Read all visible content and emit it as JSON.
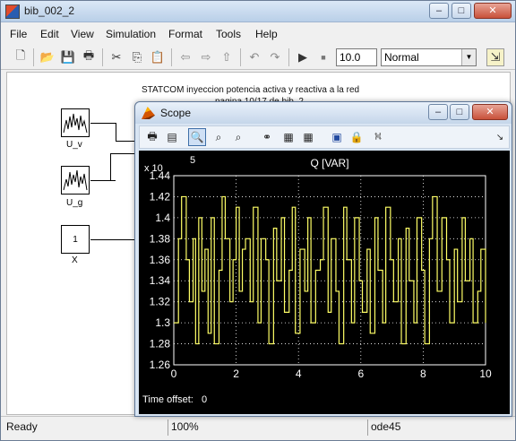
{
  "window": {
    "title": "bib_002_2",
    "controls": [
      "–",
      "□",
      "✕"
    ]
  },
  "menubar": [
    "File",
    "Edit",
    "View",
    "Simulation",
    "Format",
    "Tools",
    "Help"
  ],
  "toolbar": {
    "icons": [
      "new-icon",
      "open-icon",
      "save-icon",
      "print-icon",
      "cut-icon",
      "copy-icon",
      "paste-icon",
      "back-icon",
      "forward-icon",
      "up-icon",
      "undo-icon",
      "redo-icon",
      "play-icon",
      "stop-icon"
    ],
    "sim_time": "10.0",
    "sim_mode": "Normal"
  },
  "model": {
    "note_line1": "STATCOM inyeccion potencia activa y reactiva a la red",
    "note_line2": "pagina 10/17 de bib_2",
    "blocks": [
      {
        "label": "U_v",
        "content": ""
      },
      {
        "label": "U_g",
        "content": ""
      },
      {
        "label": "X",
        "content": "1"
      }
    ]
  },
  "scope": {
    "title": "Scope",
    "toolbar_icons": [
      "print-icon",
      "params-icon",
      "zoom-icon",
      "zoom-x-icon",
      "zoom-y-icon",
      "binoculars-icon",
      "save-axes-icon",
      "restore-axes-icon",
      "float-icon",
      "lock-icon",
      "signal-selection-icon"
    ],
    "time_offset_label": "Time offset:",
    "time_offset_value": "0"
  },
  "status": {
    "left": "Ready",
    "zoom": "100%",
    "solver": "ode45"
  },
  "chart_data": {
    "type": "line",
    "title": "Q [VAR]",
    "exponent_label": "x 10",
    "exponent_power": "5",
    "xlim": [
      0,
      10
    ],
    "ylim": [
      1.26,
      1.44
    ],
    "xticks": [
      0,
      2,
      4,
      6,
      8,
      10
    ],
    "yticks": [
      1.26,
      1.28,
      1.3,
      1.32,
      1.34,
      1.36,
      1.38,
      1.4,
      1.42,
      1.44
    ],
    "grid": true,
    "line_color": "#ffff66",
    "series": [
      {
        "step": true,
        "x": [
          0,
          0.15,
          0.25,
          0.4,
          0.5,
          0.62,
          0.7,
          0.8,
          0.9,
          1.0,
          1.1,
          1.2,
          1.3,
          1.45,
          1.55,
          1.65,
          1.8,
          1.9,
          2.0,
          2.1,
          2.2,
          2.3,
          2.45,
          2.55,
          2.7,
          2.8,
          2.95,
          3.05,
          3.2,
          3.3,
          3.45,
          3.55,
          3.7,
          3.8,
          3.9,
          4.05,
          4.2,
          4.3,
          4.4,
          4.55,
          4.7,
          4.8,
          4.95,
          5.05,
          5.2,
          5.3,
          5.45,
          5.55,
          5.7,
          5.8,
          5.95,
          6.05,
          6.2,
          6.3,
          6.45,
          6.55,
          6.7,
          6.8,
          6.95,
          7.05,
          7.2,
          7.3,
          7.45,
          7.55,
          7.7,
          7.8,
          7.95,
          8.05,
          8.2,
          8.3,
          8.45,
          8.6,
          8.75,
          8.85,
          9.0,
          9.1,
          9.25,
          9.35,
          9.5,
          9.6,
          9.75,
          9.85,
          10.0
        ],
        "y": [
          1.3,
          1.38,
          1.42,
          1.36,
          1.32,
          1.38,
          1.28,
          1.4,
          1.33,
          1.37,
          1.29,
          1.4,
          1.28,
          1.35,
          1.42,
          1.38,
          1.32,
          1.36,
          1.41,
          1.33,
          1.37,
          1.38,
          1.32,
          1.41,
          1.3,
          1.38,
          1.36,
          1.28,
          1.39,
          1.34,
          1.4,
          1.31,
          1.35,
          1.41,
          1.29,
          1.37,
          1.33,
          1.4,
          1.3,
          1.35,
          1.36,
          1.41,
          1.31,
          1.38,
          1.33,
          1.28,
          1.41,
          1.36,
          1.3,
          1.4,
          1.34,
          1.31,
          1.37,
          1.29,
          1.4,
          1.35,
          1.3,
          1.41,
          1.36,
          1.32,
          1.38,
          1.28,
          1.39,
          1.34,
          1.3,
          1.4,
          1.35,
          1.28,
          1.38,
          1.42,
          1.33,
          1.4,
          1.36,
          1.3,
          1.37,
          1.32,
          1.4,
          1.34,
          1.38,
          1.3,
          1.33,
          1.37,
          1.3
        ]
      }
    ]
  }
}
